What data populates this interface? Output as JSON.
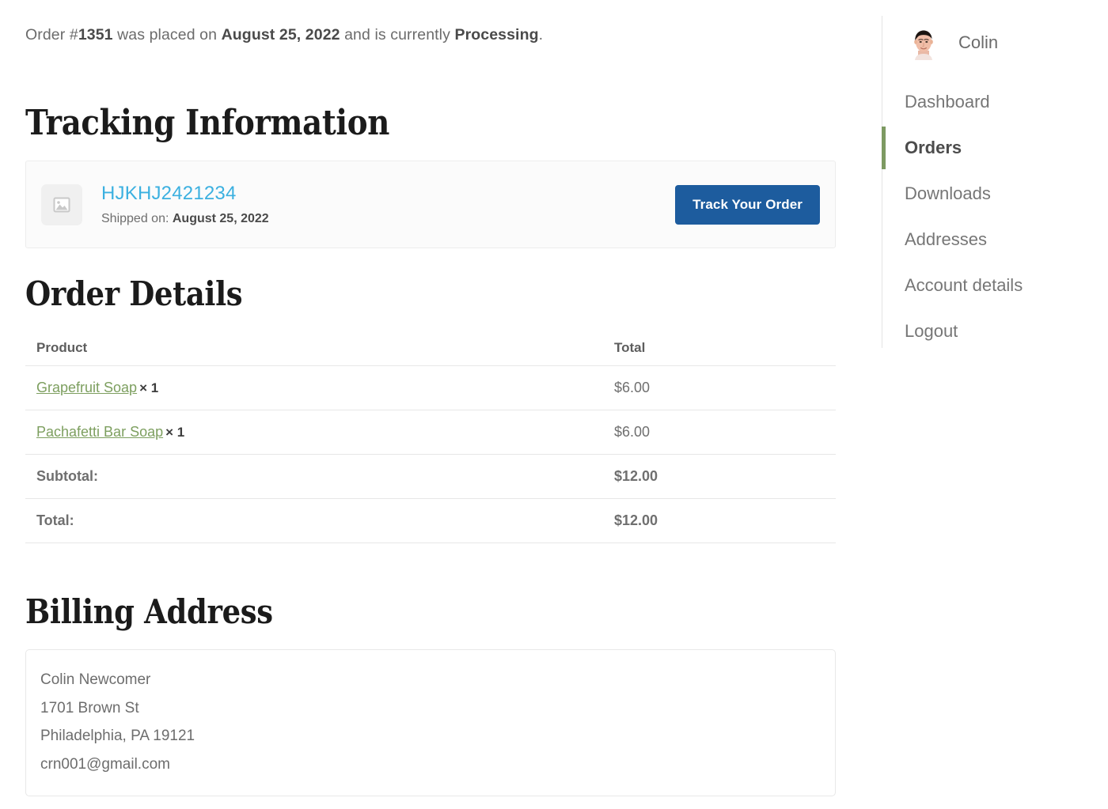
{
  "order_status": {
    "prefix": "Order #",
    "order_number": "1351",
    "middle": " was placed on ",
    "date": "August 25, 2022",
    "suffix": " and is currently ",
    "status": "Processing",
    "period": "."
  },
  "tracking": {
    "heading": "Tracking Information",
    "thumbnail_icon": "image-placeholder-icon",
    "tracking_number": "HJKHJ2421234",
    "shipped_label": "Shipped on:",
    "shipped_date": "August 25, 2022",
    "track_button_label": "Track Your Order"
  },
  "order_details": {
    "heading": "Order Details",
    "columns": [
      "Product",
      "Total"
    ],
    "items": [
      {
        "name": "Grapefruit Soap",
        "qty": "× 1",
        "total": "$6.00"
      },
      {
        "name": "Pachafetti Bar Soap",
        "qty": "× 1",
        "total": "$6.00"
      }
    ],
    "summary": [
      {
        "label": "Subtotal:",
        "value": "$12.00"
      },
      {
        "label": "Total:",
        "value": "$12.00"
      }
    ]
  },
  "billing": {
    "heading": "Billing Address",
    "lines": [
      "Colin Newcomer",
      "1701 Brown St",
      "Philadelphia, PA 19121",
      "crn001@gmail.com"
    ]
  },
  "sidebar": {
    "username": "Colin",
    "avatar_icon": "user-avatar-photo",
    "items": [
      {
        "label": "Dashboard",
        "active": false
      },
      {
        "label": "Orders",
        "active": true
      },
      {
        "label": "Downloads",
        "active": false
      },
      {
        "label": "Addresses",
        "active": false
      },
      {
        "label": "Account details",
        "active": false
      },
      {
        "label": "Logout",
        "active": false
      }
    ]
  },
  "colors": {
    "link_blue": "#3bb0e0",
    "button_blue": "#1d5c9e",
    "product_link_green": "#7d9f5f",
    "active_indicator_green": "#7d9a62",
    "text_gray": "#6b6b6b"
  }
}
